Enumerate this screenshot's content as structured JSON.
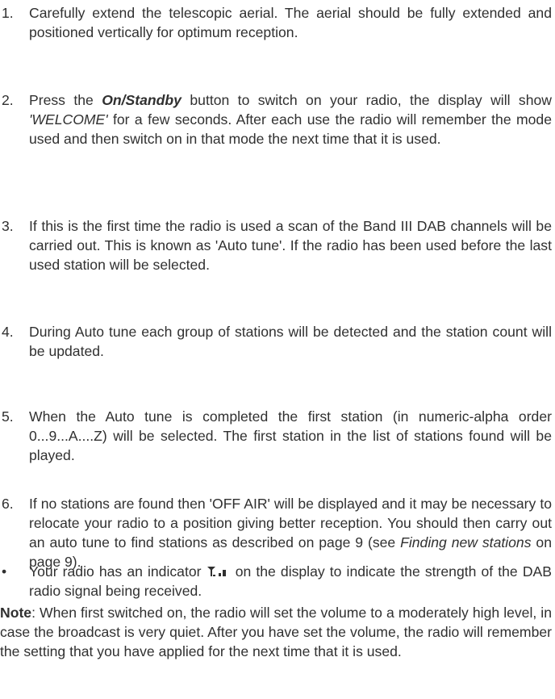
{
  "steps": [
    {
      "number": "1.",
      "text": "Carefully extend the telescopic aerial. The aerial should be fully extended and positioned vertically for optimum reception."
    },
    {
      "number": "2.",
      "pre": "Press the ",
      "button_name": "On/Standby",
      "mid": " button to switch on your radio, the display will show ",
      "display_text": "'WELCOME'",
      "post": " for a few seconds. After each use the radio will remember the mode used and then switch on in that mode the next time that it is used."
    },
    {
      "number": "3.",
      "text": "If this is the first time the radio is used a scan of the Band III DAB channels will be carried out. This is known as 'Auto tune'. If the radio has been used before the last used station will be selected."
    },
    {
      "number": "4.",
      "text": "During Auto tune each group of stations will be detected and the station count will be updated."
    },
    {
      "number": "5.",
      "text": "When the Auto tune is completed the first station (in numeric-alpha order 0...9...A....Z) will be selected. The first station in the list of stations found will be played."
    },
    {
      "number": "6.",
      "pre": "If no stations are found then 'OFF AIR' will be displayed and it may be necessary to relocate your radio to a position giving better reception. You should then carry out an auto tune to find stations as described on page 9 (see ",
      "link_text": "Finding new stations",
      "post": " on page 9)."
    }
  ],
  "bullet": {
    "mark": "•",
    "pre": "Your radio has an indicator ",
    "icon": "signal-strength-icon",
    "post": " on the display to indicate the strength of the DAB radio signal being received."
  },
  "note": {
    "label": "Note",
    "text": ": When first switched on, the radio will set the volume to a moderately high level, in case the broadcast is very quiet. After you have set the volume, the radio will remember the setting that you have applied for the next time that it is used."
  },
  "colors": {
    "text": "#303030",
    "background": "#ffffff"
  }
}
